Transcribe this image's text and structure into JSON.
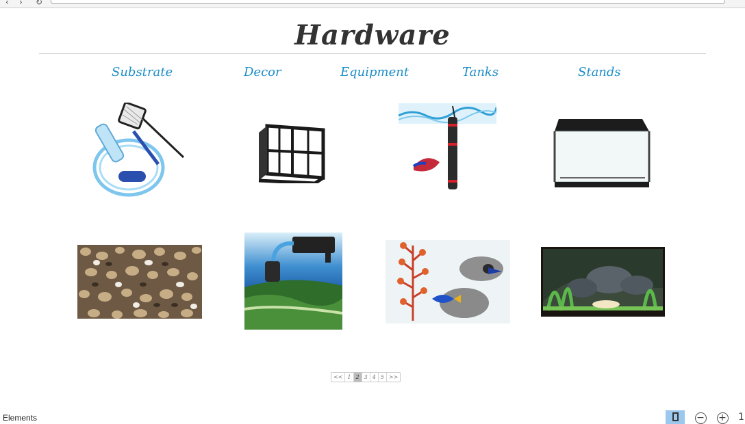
{
  "header": {
    "title": "Hardware"
  },
  "nav": {
    "categories": [
      "Substrate",
      "Decor",
      "Equipment",
      "Tanks",
      "Stands"
    ]
  },
  "products": [
    {
      "name": "Gravel vacuum with fish net",
      "icon": "siphon-net-icon"
    },
    {
      "name": "Aquarium stand frame",
      "icon": "stand-frame-icon"
    },
    {
      "name": "Aquarium heater with betta",
      "icon": "heater-icon"
    },
    {
      "name": "Glass tank with hood",
      "icon": "tank-icon"
    },
    {
      "name": "River pebbles gravel",
      "icon": "gravel-icon"
    },
    {
      "name": "Hang-on filter",
      "icon": "filter-icon"
    },
    {
      "name": "Plant and rock decorations",
      "icon": "decor-icon"
    },
    {
      "name": "Aquascaped tank",
      "icon": "aquascape-icon"
    }
  ],
  "pager": {
    "first": "<<",
    "pages": [
      "1",
      "2",
      "3",
      "4",
      "5"
    ],
    "current": "2",
    "last": ">>"
  },
  "devtools": {
    "panel_label": "Elements",
    "zoom_out": "−",
    "zoom_in": "+",
    "zoom_level": "1"
  }
}
